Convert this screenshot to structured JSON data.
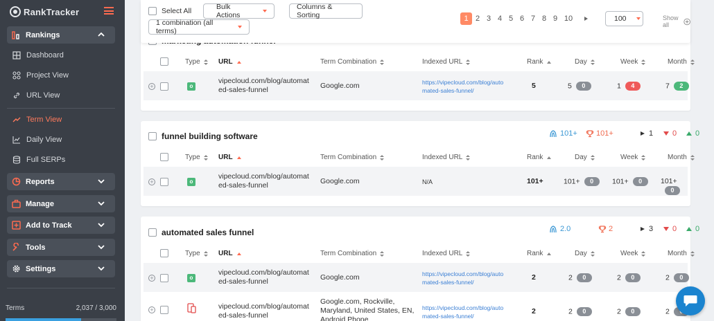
{
  "app": {
    "logo_text": "RankTracker"
  },
  "sidebar": {
    "groups": {
      "rankings": "Rankings",
      "reports": "Reports",
      "manage": "Manage",
      "add_to_track": "Add to Track",
      "tools": "Tools",
      "settings": "Settings"
    },
    "items": {
      "dashboard": "Dashboard",
      "project_view": "Project View",
      "url_view": "URL View",
      "term_view": "Term View",
      "daily_view": "Daily View",
      "full_serps": "Full SERPs"
    },
    "terms_label": "Terms",
    "terms_count": "2,037 / 3,000",
    "terms_fraction": 0.679,
    "active_color": "#ff7a5c"
  },
  "toolbar": {
    "select_all": "Select All",
    "bulk_actions": "Bulk Actions",
    "columns_sorting": "Columns & Sorting",
    "combination": "1 combination (all terms)",
    "pages": [
      "1",
      "2",
      "3",
      "4",
      "5",
      "6",
      "7",
      "8",
      "9",
      "10"
    ],
    "per_page": "100",
    "show_all": "Show all"
  },
  "columns": {
    "type": "Type",
    "url": "URL",
    "term_combination": "Term Combination",
    "indexed_url": "Indexed URL",
    "rank": "Rank",
    "day": "Day",
    "week": "Week",
    "month": "Month"
  },
  "sections": [
    {
      "title": "marketing automation funnel",
      "row": {
        "url_line1": "vipecloud.com/blog/automat",
        "url_line2": "ed-sales-funnel",
        "term": "Google.com",
        "indexed_line1": "https://vipecloud.com/blog/auto",
        "indexed_line2": "mated-sales-funnel/",
        "rank": "5",
        "day": "5",
        "day_badge": "0",
        "week": "1",
        "week_badge": "4",
        "month": "7",
        "month_badge": "2"
      }
    },
    {
      "title": "funnel building software",
      "stats": {
        "avg": "101+",
        "best": "101+",
        "neutral": "1",
        "down": "0",
        "up": "0"
      },
      "row": {
        "url_line1": "vipecloud.com/blog/automat",
        "url_line2": "ed-sales-funnel",
        "term": "Google.com",
        "indexed": "N/A",
        "rank": "101+",
        "day": "101+",
        "day_badge": "0",
        "week": "101+",
        "week_badge": "0",
        "month": "101+",
        "month_badge": "0"
      }
    },
    {
      "title": "automated sales funnel",
      "stats": {
        "avg": "2.0",
        "best": "2",
        "neutral": "3",
        "down": "0",
        "up": "0"
      },
      "rows": [
        {
          "url_line1": "vipecloud.com/blog/automat",
          "url_line2": "ed-sales-funnel",
          "term": "Google.com",
          "indexed_line1": "https://vipecloud.com/blog/auto",
          "indexed_line2": "mated-sales-funnel/",
          "rank": "2",
          "day": "2",
          "day_badge": "0",
          "week": "2",
          "week_badge": "0",
          "month": "2",
          "month_badge": "0"
        },
        {
          "url_line1": "vipecloud.com/blog/automat",
          "url_line2": "ed-sales-funnel",
          "term_line1": "Google.com, Rockville,",
          "term_line2": "Maryland, United States, EN,",
          "term_line3": "Android Phone",
          "indexed_line1": "https://vipecloud.com/blog/auto",
          "indexed_line2": "mated-sales-funnel/",
          "rank": "2",
          "day": "2",
          "day_badge": "0",
          "week": "2",
          "week_badge": "0",
          "month": "2",
          "month_badge": "0"
        }
      ]
    }
  ]
}
